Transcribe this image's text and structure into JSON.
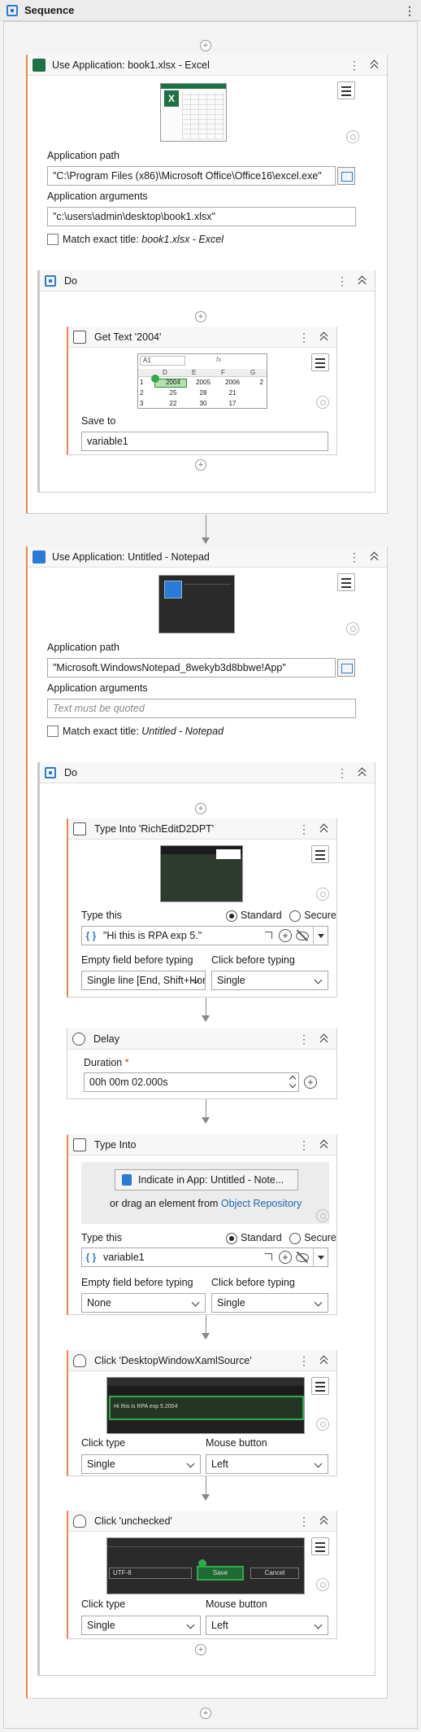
{
  "sequence": {
    "title": "Sequence"
  },
  "excel": {
    "title": "Use Application: book1.xlsx - Excel",
    "path_label": "Application path",
    "path_value": "\"C:\\Program Files (x86)\\Microsoft Office\\Office16\\excel.exe\"",
    "args_label": "Application arguments",
    "args_value": "\"c:\\users\\admin\\desktop\\book1.xlsx\"",
    "match_label": "Match exact title: ",
    "match_title": "book1.xlsx - Excel",
    "do_label": "Do",
    "get_text": {
      "title": "Get Text '2004'",
      "cell_ref": "A1",
      "fx": "fx",
      "cols": [
        "D",
        "E",
        "F",
        "G"
      ],
      "rows": [
        [
          "1",
          "2004",
          "2005",
          "2006",
          "2"
        ],
        [
          "2",
          "25",
          "28",
          "21",
          ""
        ],
        [
          "3",
          "22",
          "30",
          "17",
          ""
        ]
      ],
      "save_label": "Save to",
      "save_value": "variable1"
    }
  },
  "notepad": {
    "title": "Use Application: Untitled - Notepad",
    "path_label": "Application path",
    "path_value": "\"Microsoft.WindowsNotepad_8wekyb3d8bbwe!App\"",
    "args_label": "Application arguments",
    "args_placeholder": "Text must be quoted",
    "match_label": "Match exact title: ",
    "match_title": "Untitled - Notepad",
    "do_label": "Do",
    "type1": {
      "title": "Type Into 'RichEditD2DPT'",
      "type_label": "Type this",
      "standard": "Standard",
      "secure": "Secure",
      "value": "\"Hi this is RPA exp 5.\"",
      "empty_label": "Empty field before typing",
      "empty_value": "Single line [End, Shift+Home",
      "click_label": "Click before typing",
      "click_value": "Single"
    },
    "delay": {
      "title": "Delay",
      "duration_label": "Duration",
      "req": "*",
      "duration_value": "00h 00m 02.000s"
    },
    "type2": {
      "title": "Type Into",
      "indicate": "Indicate in App: Untitled - Note...",
      "drag_text": "or drag an element from ",
      "repo_link": "Object Repository",
      "type_label": "Type this",
      "standard": "Standard",
      "secure": "Secure",
      "value": "variable1",
      "empty_label": "Empty field before typing",
      "empty_value": "None",
      "click_label": "Click before typing",
      "click_value": "Single"
    },
    "click1": {
      "title": "Click 'DesktopWindowXamlSource'",
      "thumb_text": "Hi this is RPA exp 5.2004",
      "click_type_label": "Click type",
      "click_type_value": "Single",
      "mouse_label": "Mouse button",
      "mouse_value": "Left"
    },
    "click2": {
      "title": "Click 'unchecked'",
      "thumb_enc": "UTF-8",
      "thumb_save": "Save",
      "thumb_cancel": "Cancel",
      "click_type_label": "Click type",
      "click_type_value": "Single",
      "mouse_label": "Mouse button",
      "mouse_value": "Left"
    }
  },
  "icons": {
    "add": "+",
    "plus_small": "+"
  }
}
